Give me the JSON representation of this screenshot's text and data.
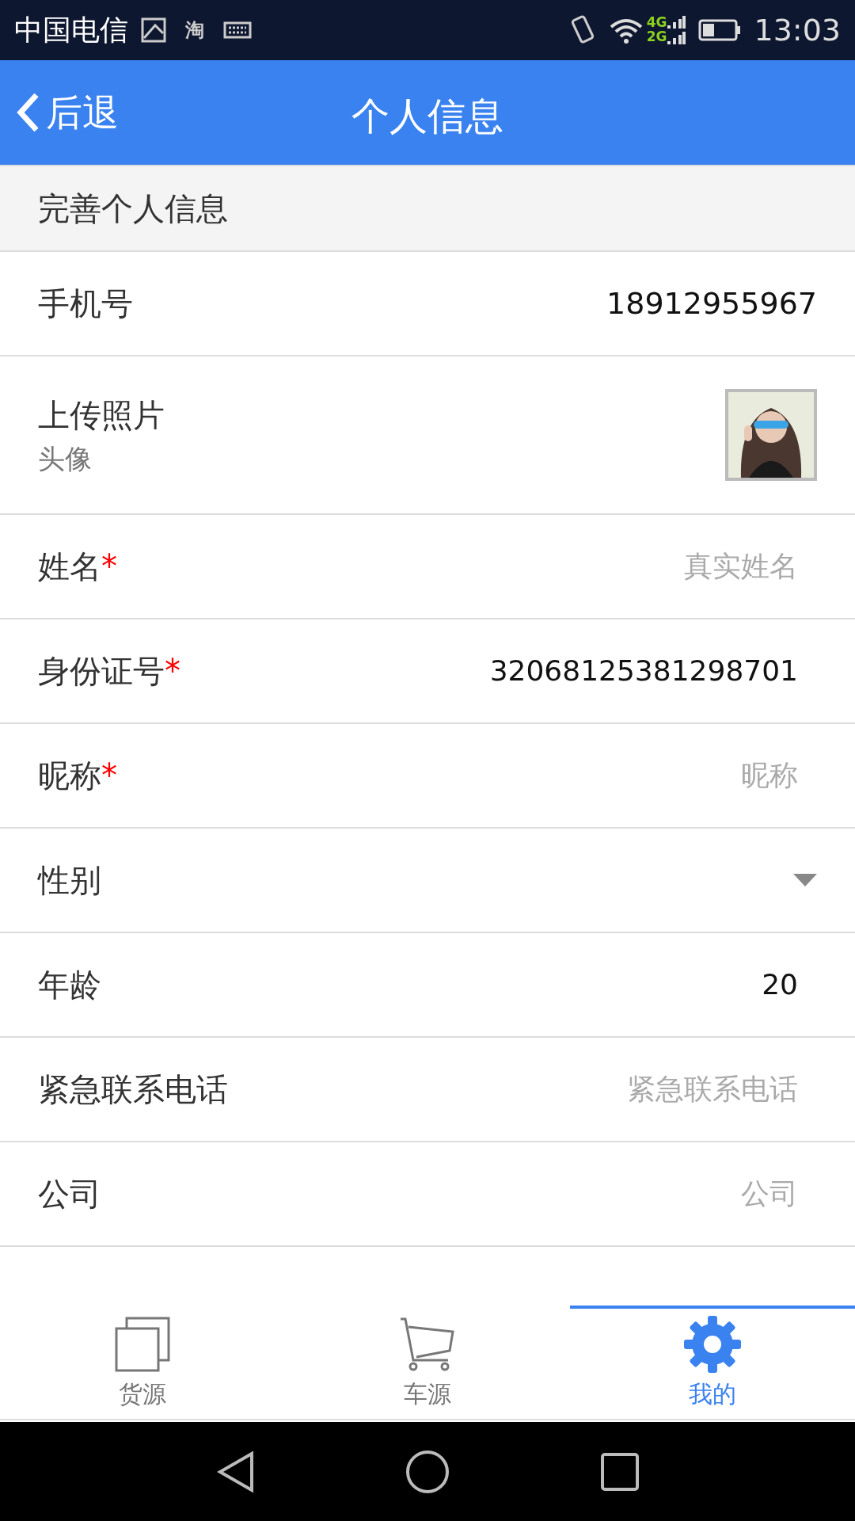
{
  "status_bar": {
    "carrier": "中国电信",
    "app_glyph": "淘",
    "net_top": "4G",
    "net_bottom": "2G",
    "time": "13:03"
  },
  "app_bar": {
    "back": "后退",
    "title": "个人信息"
  },
  "section": "完善个人信息",
  "rows": [
    {
      "kind": "text",
      "label": "手机号",
      "value": "18912955967"
    },
    {
      "label": "上传照片",
      "sublabel": "头像"
    },
    {
      "kind": "input",
      "label": "姓名",
      "required_mark": "*",
      "placeholder": "真实姓名"
    },
    {
      "kind": "input",
      "label": "身份证号",
      "required_mark": "*",
      "value": "32068125381298701"
    },
    {
      "kind": "input",
      "label": "昵称",
      "required_mark": "*",
      "placeholder": "昵称"
    },
    {
      "kind": "select",
      "label": "性别"
    },
    {
      "kind": "input",
      "label": "年龄",
      "value": "20"
    },
    {
      "kind": "input",
      "label": "紧急联系电话",
      "placeholder": "紧急联系电话"
    },
    {
      "kind": "input",
      "label": "公司",
      "placeholder": "公司"
    }
  ],
  "tabs": [
    {
      "kind": "goods",
      "label": "货源",
      "selected": false
    },
    {
      "kind": "cart",
      "label": "车源",
      "selected": false
    },
    {
      "kind": "gear",
      "label": "我的",
      "selected": true
    }
  ]
}
